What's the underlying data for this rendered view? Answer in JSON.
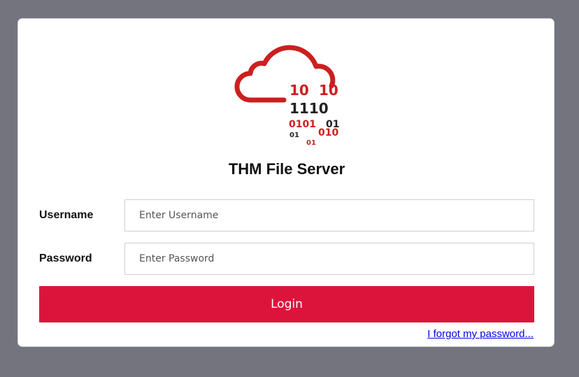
{
  "app": {
    "title": "THM File Server"
  },
  "logo": {
    "binary_lines": [
      "10",
      "10",
      "1110",
      "0101",
      "01",
      "01",
      "010",
      "01"
    ]
  },
  "form": {
    "username_label": "Username",
    "username_placeholder": "Enter Username",
    "password_label": "Password",
    "password_placeholder": "Enter Password",
    "login_label": "Login",
    "forgot_label": "I forgot my password..."
  },
  "colors": {
    "background": "#74747f",
    "card": "#ffffff",
    "accent": "#dc143c",
    "logo_red": "#cc1f1f",
    "logo_dark": "#222222",
    "link": "#0000ee"
  }
}
